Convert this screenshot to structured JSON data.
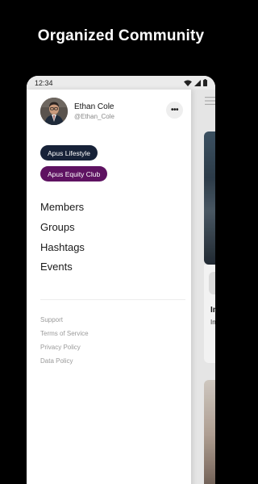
{
  "banner": {
    "headline": "Organized Community"
  },
  "status_bar": {
    "time": "12:34",
    "icons": [
      "wifi-icon",
      "signal-icon",
      "battery-icon"
    ]
  },
  "drawer": {
    "user": {
      "name": "Ethan Cole",
      "handle": "@Ethan_Cole",
      "avatar": "avatar-photo"
    },
    "more_label": "•••",
    "communities": [
      {
        "label": "Apus Lifestyle",
        "color": "#172238"
      },
      {
        "label": "Apus Equity Club",
        "color": "#5e1261"
      }
    ],
    "nav": [
      {
        "label": "Members"
      },
      {
        "label": "Groups"
      },
      {
        "label": "Hashtags"
      },
      {
        "label": "Events"
      }
    ],
    "footer_links": [
      {
        "label": "Support"
      },
      {
        "label": "Terms of Service"
      },
      {
        "label": "Privacy Policy"
      },
      {
        "label": "Data Policy"
      }
    ]
  },
  "background_app": {
    "menu_icon": "hamburger-icon",
    "fragments": {
      "title": "In",
      "subtitle": "In"
    }
  },
  "colors": {
    "page_background": "#000000",
    "headline": "#ffffff",
    "status_bar": "#ebebeb",
    "chip_primary": "#172238",
    "chip_secondary": "#5e1261"
  }
}
